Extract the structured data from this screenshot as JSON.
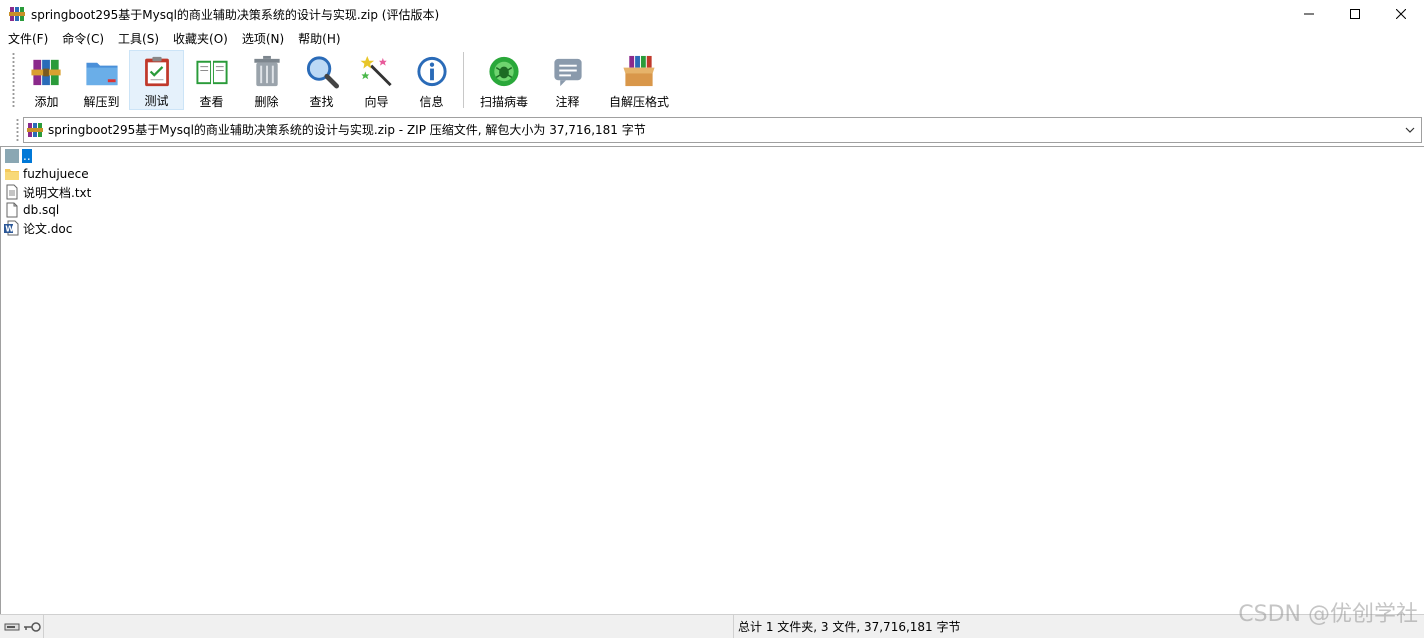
{
  "window": {
    "title": "springboot295基于Mysql的商业辅助决策系统的设计与实现.zip (评估版本)"
  },
  "menu": [
    {
      "label": "文件(F)"
    },
    {
      "label": "命令(C)"
    },
    {
      "label": "工具(S)"
    },
    {
      "label": "收藏夹(O)"
    },
    {
      "label": "选项(N)"
    },
    {
      "label": "帮助(H)"
    }
  ],
  "toolbar": {
    "buttons": [
      {
        "label": "添加",
        "icon": "add-archive-icon"
      },
      {
        "label": "解压到",
        "icon": "extract-to-icon"
      },
      {
        "label": "测试",
        "icon": "test-icon"
      },
      {
        "label": "查看",
        "icon": "view-book-icon"
      },
      {
        "label": "删除",
        "icon": "trash-icon"
      },
      {
        "label": "查找",
        "icon": "find-magnifier-icon"
      },
      {
        "label": "向导",
        "icon": "wizard-wand-icon"
      },
      {
        "label": "信息",
        "icon": "info-icon"
      },
      {
        "label": "扫描病毒",
        "icon": "virus-scan-icon"
      },
      {
        "label": "注释",
        "icon": "comment-icon"
      },
      {
        "label": "自解压格式",
        "icon": "sfx-box-icon"
      }
    ]
  },
  "address": {
    "text": "springboot295基于Mysql的商业辅助决策系统的设计与实现.zip - ZIP 压缩文件, 解包大小为 37,716,181 字节"
  },
  "files": [
    {
      "name": "..",
      "type": "parent",
      "selected": true
    },
    {
      "name": "fuzhujuece",
      "type": "folder",
      "selected": false
    },
    {
      "name": "说明文档.txt",
      "type": "text",
      "selected": false
    },
    {
      "name": "db.sql",
      "type": "file",
      "selected": false
    },
    {
      "name": "论文.doc",
      "type": "word",
      "selected": false
    }
  ],
  "status": {
    "summary": "总计 1 文件夹, 3 文件, 37,716,181 字节"
  },
  "watermark": "CSDN @优创学社",
  "colors": {
    "selection": "#0078d7",
    "active_tool_bg": "#e5f1fb"
  }
}
